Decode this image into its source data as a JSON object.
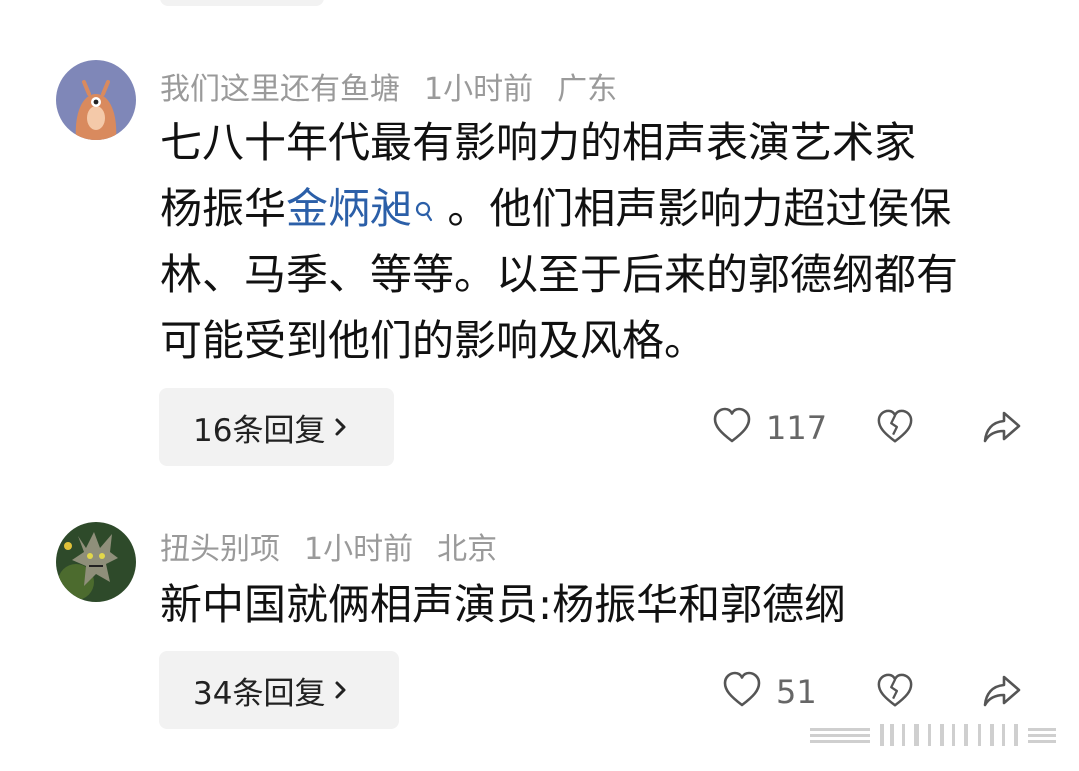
{
  "comments": [
    {
      "username": "我们这里还有鱼塘",
      "time": "1小时前",
      "location": "广东",
      "lines": [
        {
          "pre": "七八十年代最有影响力的相声表演艺术家",
          "link": "",
          "post": ""
        },
        {
          "pre": "杨振华",
          "link": "金炳昶",
          "post": " 。他们相声影响力超过侯保"
        },
        {
          "pre": "林、马季、等等。以至于后来的郭德纲都有",
          "link": "",
          "post": ""
        },
        {
          "pre": "可能受到他们的影响及风格。",
          "link": "",
          "post": ""
        }
      ],
      "reply_label": "16条回复",
      "like_count": "117",
      "avatar_icon": "cartoon-creature-avatar"
    },
    {
      "username": "扭头别项",
      "time": "1小时前",
      "location": "北京",
      "lines": [
        {
          "pre": "新中国就俩相声演员:杨振华和郭德纲",
          "link": "",
          "post": ""
        }
      ],
      "reply_label": "34条回复",
      "like_count": "51",
      "avatar_icon": "monster-figure-avatar"
    }
  ],
  "icons": {
    "like": "heart-icon",
    "dislike": "broken-heart-icon",
    "share": "share-arrow-icon",
    "search": "search-icon",
    "chevron": "chevron-right-icon"
  },
  "colors": {
    "link": "#2b5fa8",
    "meta": "#9a9a9a",
    "reply_bg": "#f2f2f2"
  }
}
